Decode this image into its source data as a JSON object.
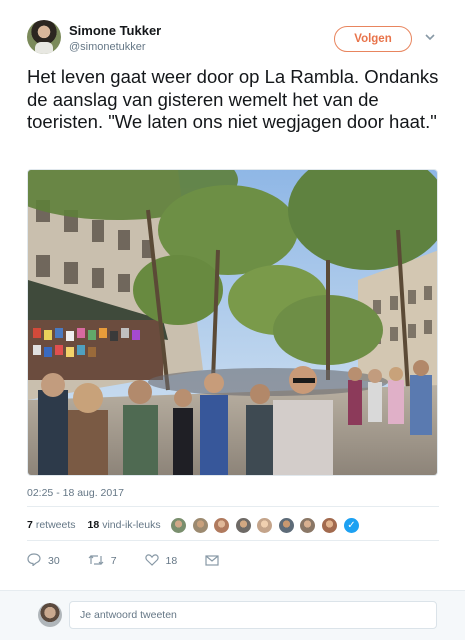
{
  "author": {
    "name": "Simone Tukker",
    "handle": "@simonetukker",
    "follow_label": "Volgen"
  },
  "tweet": {
    "text": "Het leven gaat weer door op La Rambla. Ondanks de aanslag van gisteren wemelt het van de toeristen. \"We laten ons niet wegjagen door haat.\"",
    "timestamp": "02:25 - 18 aug. 2017"
  },
  "stats": {
    "retweets_count": "7",
    "retweets_label": "retweets",
    "likes_count": "18",
    "likes_label": "vind-ik-leuks",
    "liker_colors": [
      "#7a8f6e",
      "#9c8a70",
      "#b07a5e",
      "#6e6a66",
      "#c4a48a",
      "#5d6b78",
      "#8a7766",
      "#a26a4e"
    ]
  },
  "actions": {
    "reply_count": "30",
    "retweet_count": "7",
    "like_count": "18",
    "reply_icon": "reply-icon",
    "retweet_icon": "retweet-icon",
    "like_icon": "heart-icon",
    "dm_icon": "envelope-icon"
  },
  "reply": {
    "placeholder": "Je antwoord tweeten"
  },
  "colors": {
    "follow_accent": "#e8734a",
    "verified": "#1da1f2",
    "muted": "#657786"
  }
}
